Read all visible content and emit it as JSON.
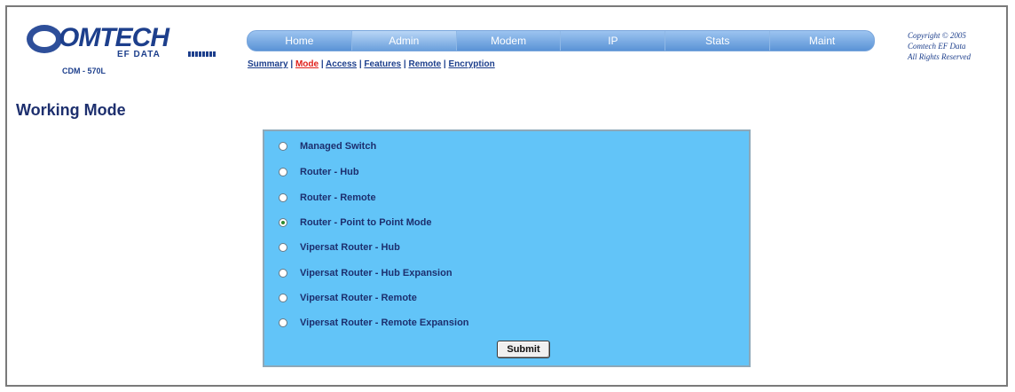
{
  "logo": {
    "wordmark": "OMTECH",
    "subtitle": "EF DATA"
  },
  "model": "CDM - 570L",
  "nav": {
    "tabs": [
      "Home",
      "Admin",
      "Modem",
      "IP",
      "Stats",
      "Maint"
    ],
    "active_tab": "Admin"
  },
  "subnav": {
    "items": [
      "Summary",
      "Mode",
      "Access",
      "Features",
      "Remote",
      "Encryption"
    ],
    "separator": " | ",
    "active_item": "Mode"
  },
  "copyright": {
    "line1": "Copyright © 2005",
    "line2": "Comtech EF Data",
    "line3": "All Rights Reserved"
  },
  "page_title": "Working Mode",
  "mode_options": [
    {
      "label": "Managed Switch",
      "selected": false
    },
    {
      "label": "Router - Hub",
      "selected": false
    },
    {
      "label": "Router - Remote",
      "selected": false
    },
    {
      "label": "Router - Point to Point Mode",
      "selected": true
    },
    {
      "label": "Vipersat Router - Hub",
      "selected": false
    },
    {
      "label": "Vipersat Router - Hub Expansion",
      "selected": false
    },
    {
      "label": "Vipersat Router - Remote",
      "selected": false
    },
    {
      "label": "Vipersat Router - Remote Expansion",
      "selected": false
    }
  ],
  "submit_label": "Submit",
  "colors": {
    "panel_bg": "#62c4f8",
    "brand_blue": "#1d3f8c",
    "active_link": "#e0201a"
  }
}
